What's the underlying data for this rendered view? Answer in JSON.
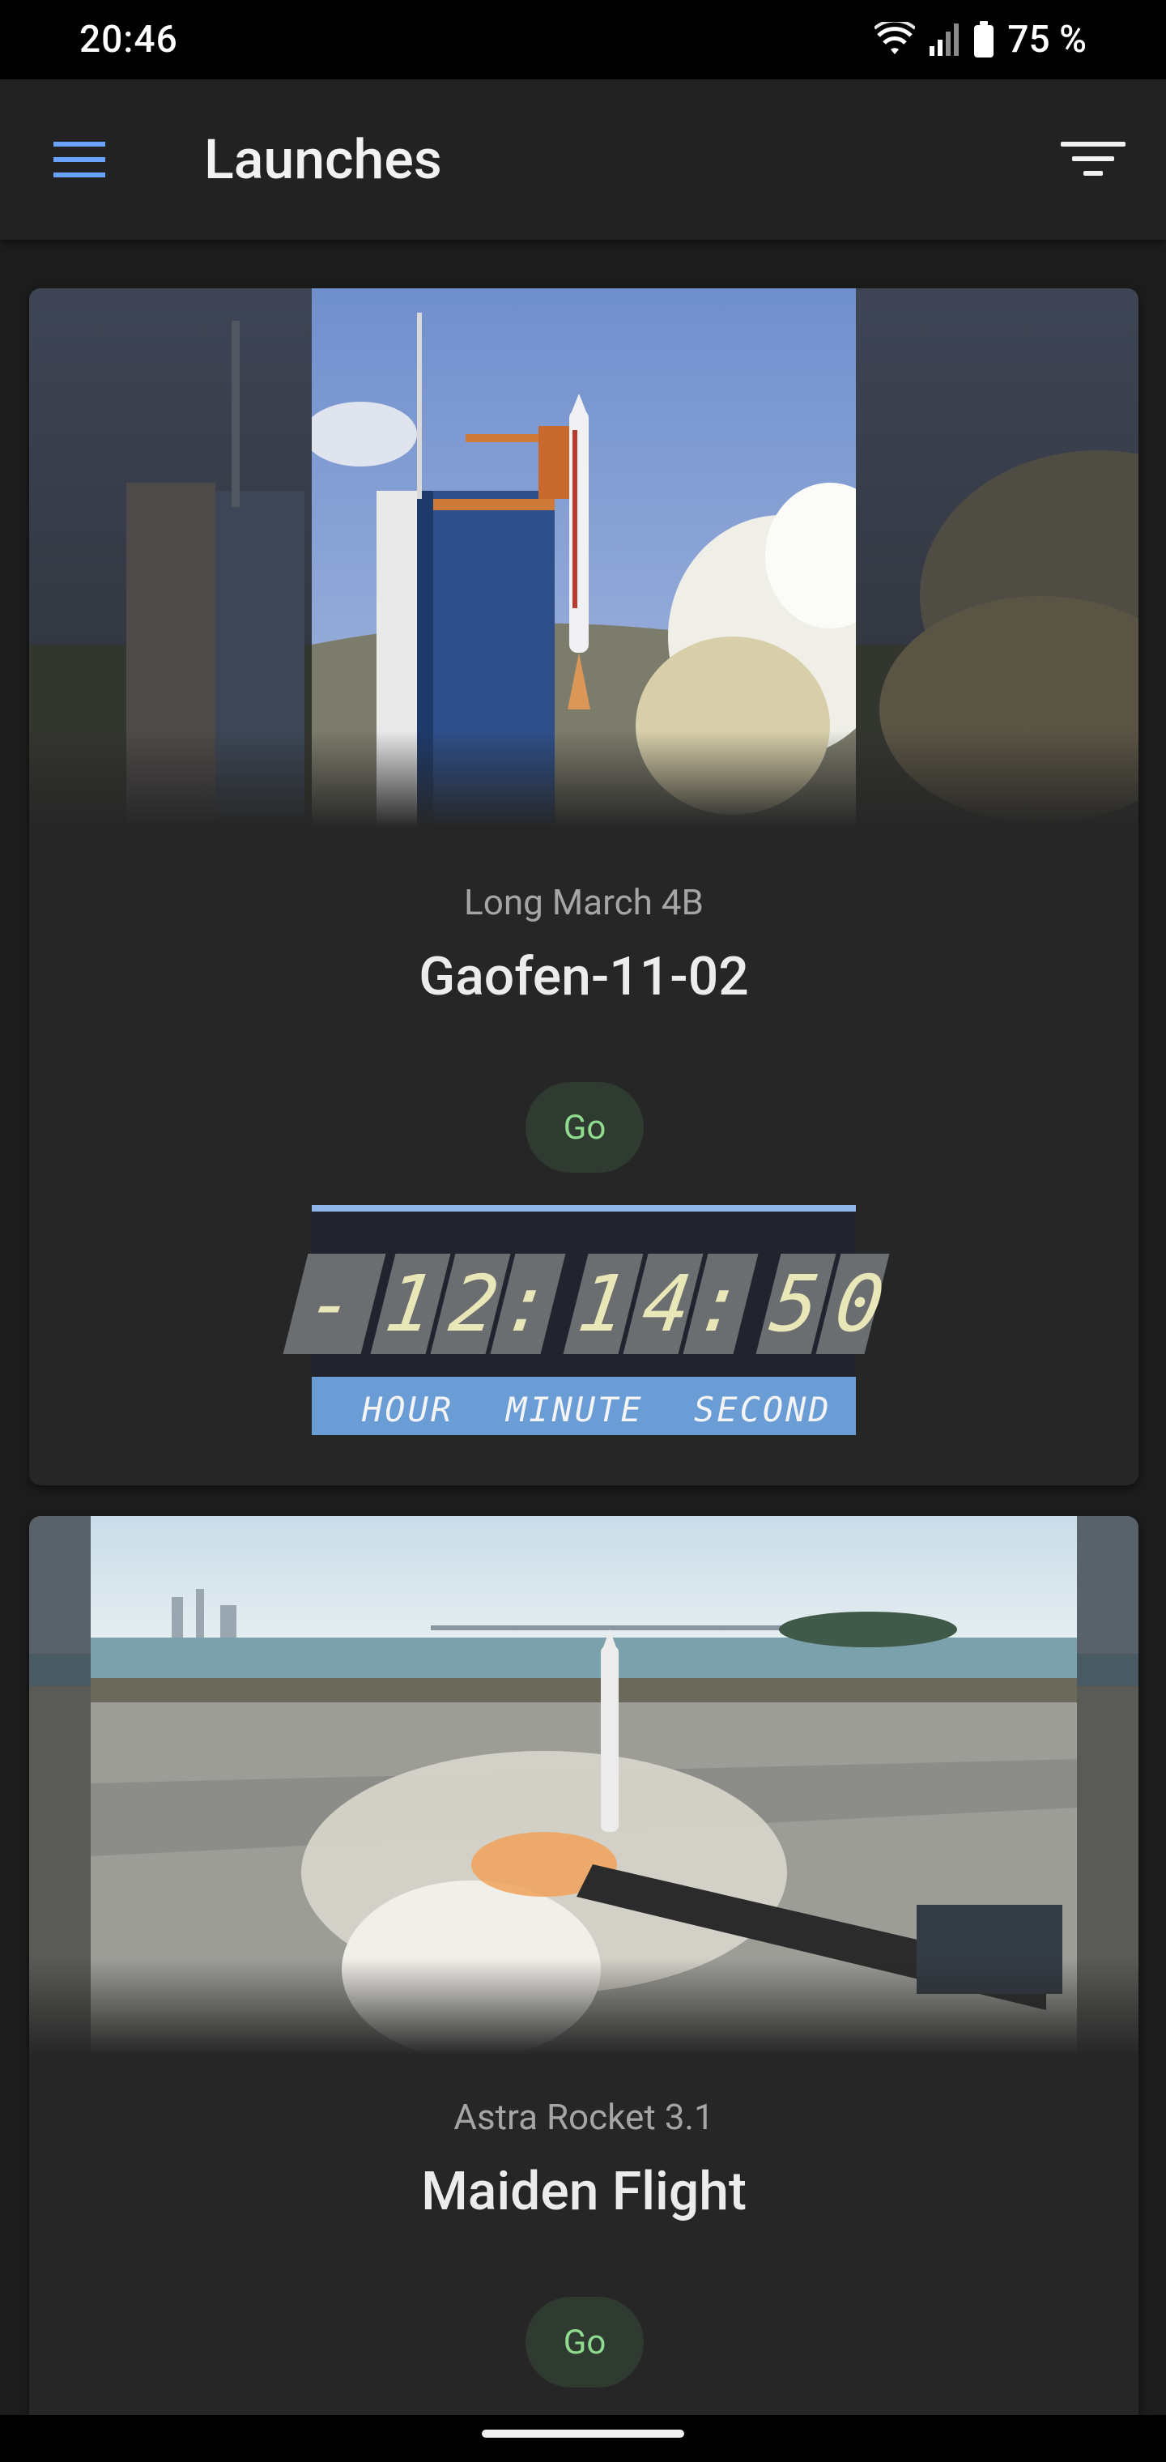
{
  "status_bar": {
    "time": "20:46",
    "battery": "75 %",
    "icons": [
      "wifi-icon",
      "cell-signal-icon",
      "battery-icon"
    ]
  },
  "app_bar": {
    "title": "Launches",
    "icons": [
      "menu-icon",
      "filter-icon"
    ],
    "accent_color": "#6aa3ff"
  },
  "launches": [
    {
      "rocket": "Long March 4B",
      "mission": "Gaofen-11-02",
      "status": "Go",
      "countdown": {
        "sign": "-",
        "hours": "12",
        "minutes": "14",
        "seconds": "50",
        "labels": [
          "HOUR",
          "MINUTE",
          "SECOND"
        ]
      }
    },
    {
      "rocket": "Astra Rocket 3.1",
      "mission": "Maiden Flight",
      "status": "Go"
    }
  ],
  "colors": {
    "status_go_text": "#8fdc8f",
    "status_go_bg": "#2f3a31",
    "countdown_digits": "#e9e6b8",
    "countdown_bar": "#6a9cd6"
  }
}
